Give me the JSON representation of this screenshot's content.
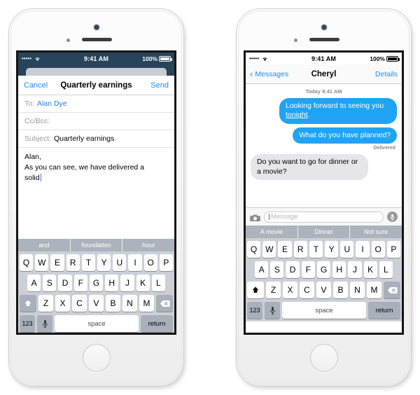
{
  "phones": {
    "left": {
      "name": "iphone-mail-compose",
      "statusbar": {
        "signal_dots": "•••••",
        "wifi_icon": "wifi-icon",
        "time": "9:41 AM",
        "battery_percent": "100%",
        "battery_icon": "battery-full-icon",
        "theme": "dark"
      },
      "compose": {
        "cancel_label": "Cancel",
        "title": "Quarterly earnings",
        "send_label": "Send",
        "to_label": "To:",
        "to_value": "Alan Dye",
        "ccbcc_label": "Cc/Bcc:",
        "subject_label": "Subject:",
        "subject_value": "Quarterly earnings",
        "body_line1": "Alan,",
        "body_line2": "As you can see, we have delivered a",
        "body_line3": "solid"
      },
      "keyboard": {
        "suggestions": [
          "and",
          "foundation",
          "hour"
        ],
        "row1": [
          "Q",
          "W",
          "E",
          "R",
          "T",
          "Y",
          "U",
          "I",
          "O",
          "P"
        ],
        "row2": [
          "A",
          "S",
          "D",
          "F",
          "G",
          "H",
          "J",
          "K",
          "L"
        ],
        "row3": [
          "Z",
          "X",
          "C",
          "V",
          "B",
          "N",
          "M"
        ],
        "shift_icon": "shift-icon",
        "shift_state": "inactive",
        "backspace_icon": "backspace-icon",
        "numbers_label": "123",
        "mic_icon": "microphone-icon",
        "space_label": "space",
        "return_label": "return"
      }
    },
    "right": {
      "name": "iphone-messages-thread",
      "statusbar": {
        "signal_dots": "•••••",
        "wifi_icon": "wifi-icon",
        "time": "9:41 AM",
        "battery_percent": "100%",
        "battery_icon": "battery-full-icon",
        "theme": "light"
      },
      "nav": {
        "back_icon": "chevron-left-icon",
        "back_label": "Messages",
        "title": "Cheryl",
        "details_label": "Details"
      },
      "thread": {
        "timestamp": "Today 9:41 AM",
        "messages": [
          {
            "direction": "out",
            "text_before": "Looking forward to seeing you ",
            "link_text": "tonight",
            "text_after": "."
          },
          {
            "direction": "out",
            "text": "What do you have planned?"
          },
          {
            "direction": "in",
            "text": "Do you want to go for dinner or a movie?"
          }
        ],
        "delivered_label": "Delivered"
      },
      "input_bar": {
        "camera_icon": "camera-icon",
        "placeholder": "Message",
        "mic_icon": "microphone-icon"
      },
      "keyboard": {
        "suggestions": [
          "A movie",
          "Dinner",
          "Not sure"
        ],
        "row1": [
          "Q",
          "W",
          "E",
          "R",
          "T",
          "Y",
          "U",
          "I",
          "O",
          "P"
        ],
        "row2": [
          "A",
          "S",
          "D",
          "F",
          "G",
          "H",
          "J",
          "K",
          "L"
        ],
        "row3": [
          "Z",
          "X",
          "C",
          "V",
          "B",
          "N",
          "M"
        ],
        "shift_icon": "shift-icon",
        "shift_state": "active",
        "backspace_icon": "backspace-icon",
        "numbers_label": "123",
        "mic_icon": "microphone-icon",
        "space_label": "space",
        "return_label": "return"
      }
    }
  },
  "colors": {
    "ios_blue": "#1a8cff",
    "bubble_blue": "#1fa3f5",
    "bubble_gray": "#e5e5ea",
    "status_dark": "#28445c",
    "keyboard_bg": "#ccd0d6",
    "suggest_bg": "#adb3bc"
  }
}
